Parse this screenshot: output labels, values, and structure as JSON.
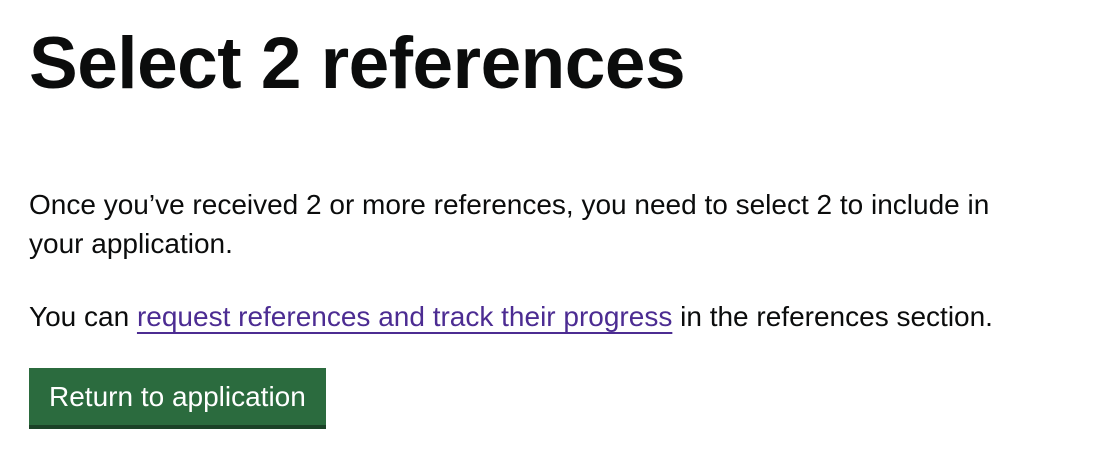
{
  "page": {
    "title": "Select 2 references",
    "intro": "Once you’ve received 2 or more references, you need to select 2 to include in your application.",
    "link_sentence": {
      "prefix": "You can ",
      "link_text": "request references and track their progress",
      "suffix": " in the references section."
    },
    "button_label": "Return to application"
  },
  "colors": {
    "text": "#0b0c0c",
    "link": "#4c2c92",
    "button": "#2b6b3e",
    "button_shadow": "#1b4227"
  }
}
